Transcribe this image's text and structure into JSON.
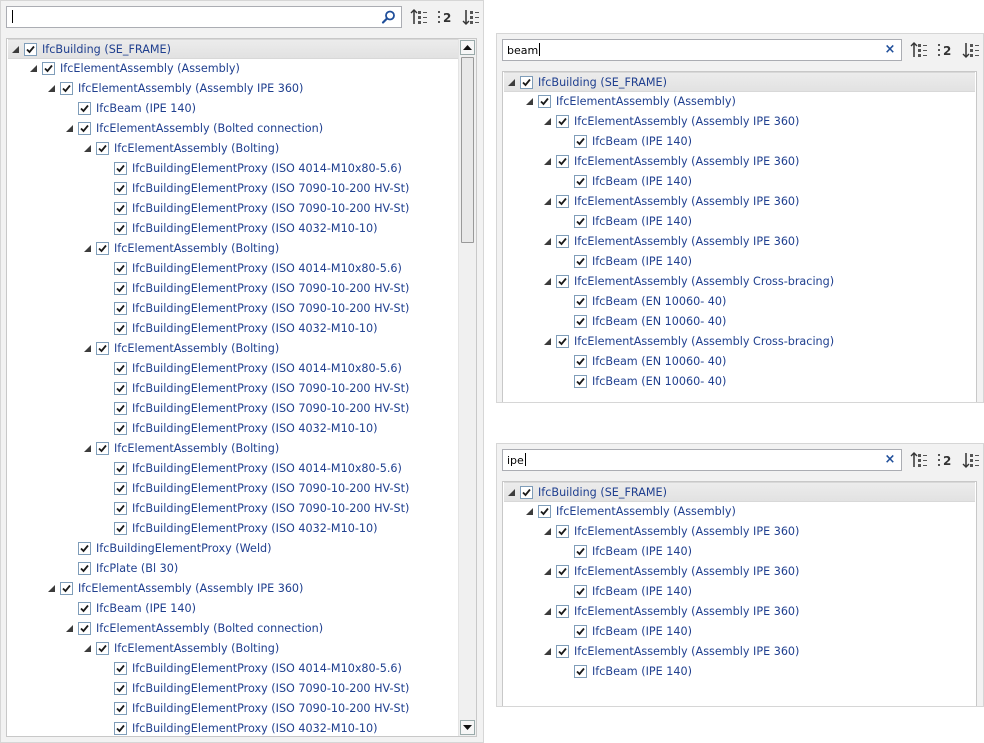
{
  "panels": [
    {
      "search": {
        "value": "",
        "has_clear": false
      },
      "tree": [
        {
          "depth": 0,
          "expander": true,
          "label": "IfcBuilding (SE_FRAME)",
          "root": true
        },
        {
          "depth": 1,
          "expander": true,
          "label": "IfcElementAssembly (Assembly)"
        },
        {
          "depth": 2,
          "expander": true,
          "label": "IfcElementAssembly (Assembly IPE 360)"
        },
        {
          "depth": 3,
          "expander": false,
          "label": "IfcBeam (IPE 140)"
        },
        {
          "depth": 3,
          "expander": true,
          "label": "IfcElementAssembly (Bolted connection)"
        },
        {
          "depth": 4,
          "expander": true,
          "label": "IfcElementAssembly (Bolting)"
        },
        {
          "depth": 5,
          "expander": false,
          "label": "IfcBuildingElementProxy (ISO 4014-M10x80-5.6)"
        },
        {
          "depth": 5,
          "expander": false,
          "label": "IfcBuildingElementProxy (ISO 7090-10-200 HV-St)"
        },
        {
          "depth": 5,
          "expander": false,
          "label": "IfcBuildingElementProxy (ISO 7090-10-200 HV-St)"
        },
        {
          "depth": 5,
          "expander": false,
          "label": "IfcBuildingElementProxy (ISO 4032-M10-10)"
        },
        {
          "depth": 4,
          "expander": true,
          "label": "IfcElementAssembly (Bolting)"
        },
        {
          "depth": 5,
          "expander": false,
          "label": "IfcBuildingElementProxy (ISO 4014-M10x80-5.6)"
        },
        {
          "depth": 5,
          "expander": false,
          "label": "IfcBuildingElementProxy (ISO 7090-10-200 HV-St)"
        },
        {
          "depth": 5,
          "expander": false,
          "label": "IfcBuildingElementProxy (ISO 7090-10-200 HV-St)"
        },
        {
          "depth": 5,
          "expander": false,
          "label": "IfcBuildingElementProxy (ISO 4032-M10-10)"
        },
        {
          "depth": 4,
          "expander": true,
          "label": "IfcElementAssembly (Bolting)"
        },
        {
          "depth": 5,
          "expander": false,
          "label": "IfcBuildingElementProxy (ISO 4014-M10x80-5.6)"
        },
        {
          "depth": 5,
          "expander": false,
          "label": "IfcBuildingElementProxy (ISO 7090-10-200 HV-St)"
        },
        {
          "depth": 5,
          "expander": false,
          "label": "IfcBuildingElementProxy (ISO 7090-10-200 HV-St)"
        },
        {
          "depth": 5,
          "expander": false,
          "label": "IfcBuildingElementProxy (ISO 4032-M10-10)"
        },
        {
          "depth": 4,
          "expander": true,
          "label": "IfcElementAssembly (Bolting)"
        },
        {
          "depth": 5,
          "expander": false,
          "label": "IfcBuildingElementProxy (ISO 4014-M10x80-5.6)"
        },
        {
          "depth": 5,
          "expander": false,
          "label": "IfcBuildingElementProxy (ISO 7090-10-200 HV-St)"
        },
        {
          "depth": 5,
          "expander": false,
          "label": "IfcBuildingElementProxy (ISO 7090-10-200 HV-St)"
        },
        {
          "depth": 5,
          "expander": false,
          "label": "IfcBuildingElementProxy (ISO 4032-M10-10)"
        },
        {
          "depth": 3,
          "expander": false,
          "label": "IfcBuildingElementProxy (Weld)"
        },
        {
          "depth": 3,
          "expander": false,
          "label": "IfcPlate (Bl 30)"
        },
        {
          "depth": 2,
          "expander": true,
          "label": "IfcElementAssembly (Assembly IPE 360)"
        },
        {
          "depth": 3,
          "expander": false,
          "label": "IfcBeam (IPE 140)"
        },
        {
          "depth": 3,
          "expander": true,
          "label": "IfcElementAssembly (Bolted connection)"
        },
        {
          "depth": 4,
          "expander": true,
          "label": "IfcElementAssembly (Bolting)"
        },
        {
          "depth": 5,
          "expander": false,
          "label": "IfcBuildingElementProxy (ISO 4014-M10x80-5.6)"
        },
        {
          "depth": 5,
          "expander": false,
          "label": "IfcBuildingElementProxy (ISO 7090-10-200 HV-St)"
        },
        {
          "depth": 5,
          "expander": false,
          "label": "IfcBuildingElementProxy (ISO 7090-10-200 HV-St)"
        },
        {
          "depth": 5,
          "expander": false,
          "label": "IfcBuildingElementProxy (ISO 4032-M10-10)"
        }
      ],
      "scrollbar": true
    },
    {
      "search": {
        "value": "beam",
        "has_clear": true
      },
      "tree": [
        {
          "depth": 0,
          "expander": true,
          "label": "IfcBuilding (SE_FRAME)",
          "root": true
        },
        {
          "depth": 1,
          "expander": true,
          "label": "IfcElementAssembly (Assembly)"
        },
        {
          "depth": 2,
          "expander": true,
          "label": "IfcElementAssembly (Assembly IPE 360)"
        },
        {
          "depth": 3,
          "expander": false,
          "label": "IfcBeam (IPE 140)"
        },
        {
          "depth": 2,
          "expander": true,
          "label": "IfcElementAssembly (Assembly IPE 360)"
        },
        {
          "depth": 3,
          "expander": false,
          "label": "IfcBeam (IPE 140)"
        },
        {
          "depth": 2,
          "expander": true,
          "label": "IfcElementAssembly (Assembly IPE 360)"
        },
        {
          "depth": 3,
          "expander": false,
          "label": "IfcBeam (IPE 140)"
        },
        {
          "depth": 2,
          "expander": true,
          "label": "IfcElementAssembly (Assembly IPE 360)"
        },
        {
          "depth": 3,
          "expander": false,
          "label": "IfcBeam (IPE 140)"
        },
        {
          "depth": 2,
          "expander": true,
          "label": "IfcElementAssembly (Assembly Cross-bracing)"
        },
        {
          "depth": 3,
          "expander": false,
          "label": "IfcBeam (EN 10060- 40)"
        },
        {
          "depth": 3,
          "expander": false,
          "label": "IfcBeam (EN 10060- 40)"
        },
        {
          "depth": 2,
          "expander": true,
          "label": "IfcElementAssembly (Assembly Cross-bracing)"
        },
        {
          "depth": 3,
          "expander": false,
          "label": "IfcBeam (EN 10060- 40)"
        },
        {
          "depth": 3,
          "expander": false,
          "label": "IfcBeam (EN 10060- 40)"
        }
      ],
      "scrollbar": false
    },
    {
      "search": {
        "value": "ipe",
        "has_clear": true
      },
      "tree": [
        {
          "depth": 0,
          "expander": true,
          "label": "IfcBuilding (SE_FRAME)",
          "root": true
        },
        {
          "depth": 1,
          "expander": true,
          "label": "IfcElementAssembly (Assembly)"
        },
        {
          "depth": 2,
          "expander": true,
          "label": "IfcElementAssembly (Assembly IPE 360)"
        },
        {
          "depth": 3,
          "expander": false,
          "label": "IfcBeam (IPE 140)"
        },
        {
          "depth": 2,
          "expander": true,
          "label": "IfcElementAssembly (Assembly IPE 360)"
        },
        {
          "depth": 3,
          "expander": false,
          "label": "IfcBeam (IPE 140)"
        },
        {
          "depth": 2,
          "expander": true,
          "label": "IfcElementAssembly (Assembly IPE 360)"
        },
        {
          "depth": 3,
          "expander": false,
          "label": "IfcBeam (IPE 140)"
        },
        {
          "depth": 2,
          "expander": true,
          "label": "IfcElementAssembly (Assembly IPE 360)"
        },
        {
          "depth": 3,
          "expander": false,
          "label": "IfcBeam (IPE 140)"
        }
      ],
      "scrollbar": false
    }
  ],
  "toolbar_icons": [
    "sort-ascending-icon",
    "sort-numeric-icon",
    "sort-descending-icon"
  ],
  "toolbar_text": {
    "numeric_label": "2"
  },
  "colors": {
    "tree_text": "#1f3f8f",
    "check_mark": "#1a1a1a",
    "panel_bg": "#f2f2f2"
  }
}
